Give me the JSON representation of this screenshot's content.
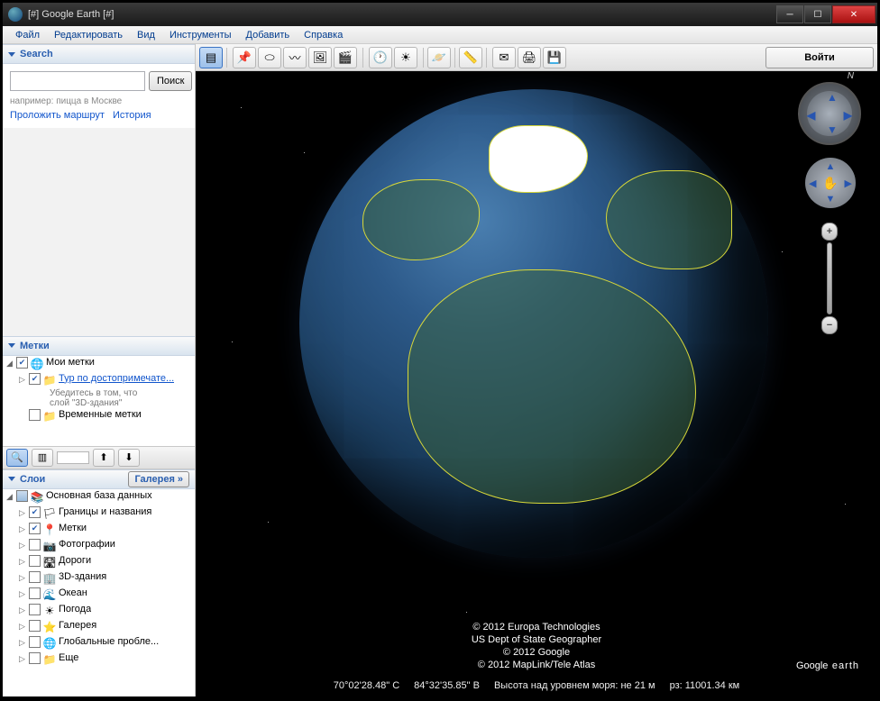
{
  "window": {
    "title": "[#] Google Earth [#]"
  },
  "menu": [
    "Файл",
    "Редактировать",
    "Вид",
    "Инструменты",
    "Добавить",
    "Справка"
  ],
  "toolbar": {
    "login": "Войти"
  },
  "search": {
    "title": "Search",
    "placeholder": "",
    "button": "Поиск",
    "hint": "например: пицца в Москве",
    "link_route": "Проложить маршрут",
    "link_history": "История"
  },
  "places": {
    "title": "Метки",
    "my": "Мои метки",
    "tour": "Тур по достопримечате...",
    "tour_sub1": "Убедитесь в том, что",
    "tour_sub2": "слой \"3D-здания\"",
    "temp": "Временные метки"
  },
  "layers": {
    "title": "Слои",
    "gallery": "Галерея",
    "base": "Основная база данных",
    "items": [
      {
        "label": "Границы и названия",
        "checked": true,
        "icon": "🏳"
      },
      {
        "label": "Метки",
        "checked": true,
        "icon": "📍"
      },
      {
        "label": "Фотографии",
        "checked": false,
        "icon": "📷"
      },
      {
        "label": "Дороги",
        "checked": false,
        "icon": "🛣"
      },
      {
        "label": "3D-здания",
        "checked": false,
        "icon": "🏢"
      },
      {
        "label": "Океан",
        "checked": false,
        "icon": "🌊"
      },
      {
        "label": "Погода",
        "checked": false,
        "icon": "☀"
      },
      {
        "label": "Галерея",
        "checked": false,
        "icon": "⭐"
      },
      {
        "label": "Глобальные пробле...",
        "checked": false,
        "icon": "🌐"
      },
      {
        "label": "Еще",
        "checked": false,
        "icon": "📁"
      }
    ]
  },
  "attrib": [
    "© 2012 Europa Technologies",
    "US Dept of State Geographer",
    "© 2012 Google",
    "© 2012 MapLink/Tele Atlas"
  ],
  "status": {
    "lat": "70°02'28.48\" С",
    "lon": "84°32'35.85\" В",
    "elev": "Высота над уровнем моря: не 21 м",
    "eye": "рз: 11001.34 км"
  },
  "brand": {
    "google": "Google",
    "earth": "earth"
  },
  "compass": {
    "n": "N"
  }
}
